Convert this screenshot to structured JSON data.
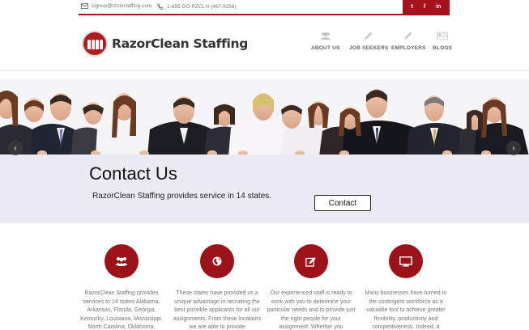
{
  "topbar": {
    "email": "signup@rzclnstaffing.com",
    "phone": "1-855 GO RZCLN (467-9256)",
    "social": [
      {
        "icon": "twitter-icon",
        "label": "t"
      },
      {
        "icon": "facebook-icon",
        "label": "f"
      },
      {
        "icon": "linkedin-icon",
        "label": "in"
      }
    ]
  },
  "header": {
    "brand": "RazorClean Staffing",
    "nav": [
      {
        "label": "ABOUT US",
        "icon": "people-icon"
      },
      {
        "label": "JOB SEEKERS",
        "icon": "pencil-icon"
      },
      {
        "label": "EMPLOYERS",
        "icon": "pencil-icon"
      },
      {
        "label": "BLOGS",
        "icon": "image-icon"
      }
    ]
  },
  "hero": {
    "title": "Contact Us",
    "subtitle": "RazorClean Staffing provides service in 14 states.",
    "button_label": "Contact",
    "prev_arrow": "‹",
    "next_arrow": "›"
  },
  "features": [
    {
      "icon": "users-icon",
      "text": "RazorClean Staffing provides services to 14 states Alabama, Arkansas, Florida, Georgia, Kentucky, Louisiana, Mississippi, North Carolina, Oklahoma,"
    },
    {
      "icon": "globe-icon",
      "text": "These states have provided us a unique advantage in recruiting the best possible applicants for all our assignments. From these locations we are able to provide"
    },
    {
      "icon": "edit-icon",
      "text": "Our experienced staff is ready to work with you to determine your particular needs and to provide just the right people for your assignment. Whether you"
    },
    {
      "icon": "monitor-icon",
      "text": "Many businesses have turned to the contingent workforce as a valuable tool to achieve greater flexibility, productivity and competitiveness. Indeed, a"
    }
  ],
  "colors": {
    "brand_red": "#a5141c",
    "banner_bg": "#eceaf2"
  }
}
